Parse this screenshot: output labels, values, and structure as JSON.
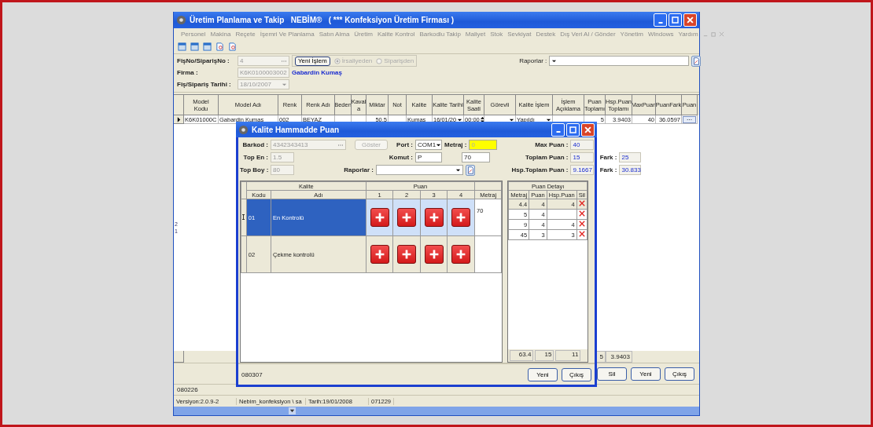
{
  "main_window": {
    "title": "Üretim Planlama ve Takip   NEBİM®   ( *** Konfeksiyon Üretim Firması )",
    "menu": [
      "Personel",
      "Makina",
      "Reçete",
      "İşemri Ve Planlama",
      "Satın Alma",
      "Üretim",
      "Kalite Kontrol",
      "Barkodlu Takip",
      "Maliyet",
      "Stok",
      "Sevkiyat",
      "Destek",
      "Dış Veri Al / Gönder",
      "Yönetim",
      "Windows",
      "Yardım"
    ],
    "form": {
      "fis_label": "FişNo/SiparişNo :",
      "fis_value": "4",
      "new_button": "Yeni İşlem",
      "sources": [
        {
          "label": "İrsaliyeden",
          "selected": true
        },
        {
          "label": "Siparişden",
          "selected": false
        }
      ],
      "reports_label": "Raporlar :",
      "firma_label": "Firma :",
      "firma_value": "K6K0100003002",
      "firma_name": "Gabardin Kumaş",
      "date_label": "Fiş/Sipariş Tarihi :",
      "date_value": "18/10/2007"
    },
    "side_marks": [
      "2",
      "1"
    ],
    "grid": {
      "columns": [
        "Model\nKodu",
        "Model Adı",
        "Renk",
        "Renk Adı",
        "Beden",
        "Kaval\na",
        "Miktar",
        "Not",
        "Kalite",
        "Kalite Tarihi",
        "Kalite\nSaati",
        "Görevli",
        "Kalite İşlem",
        "İşlem Açıklama",
        "Puan\nToplamı",
        "Hsp.Puan\nToplamı",
        "MaxPuan",
        "PuanFark",
        "Puan"
      ],
      "rows": [
        {
          "selected": true,
          "cells": [
            {
              "kind": "text",
              "text": "K6K01000C"
            },
            {
              "kind": "text",
              "text": "Gabardin Kumaş"
            },
            {
              "kind": "text",
              "text": "002"
            },
            {
              "kind": "text",
              "text": "BEYAZ"
            },
            {
              "kind": "empty"
            },
            {
              "kind": "empty"
            },
            {
              "kind": "num",
              "text": "50.5"
            },
            {
              "kind": "empty"
            },
            {
              "kind": "text",
              "text": "Kumaş"
            },
            {
              "kind": "combo",
              "text": "16/01/20"
            },
            {
              "kind": "spin",
              "text": "00:00"
            },
            {
              "kind": "combo",
              "text": ""
            },
            {
              "kind": "combo",
              "text": "Yapıldı"
            },
            {
              "kind": "empty"
            },
            {
              "kind": "num",
              "text": "5"
            },
            {
              "kind": "num",
              "text": "3.9403"
            },
            {
              "kind": "num",
              "text": "40"
            },
            {
              "kind": "num",
              "text": "36.0597"
            },
            {
              "kind": "ellipsis",
              "text": "···"
            }
          ]
        }
      ],
      "footer": [
        {
          "kind": "empty"
        },
        {
          "kind": "empty"
        },
        {
          "kind": "empty"
        },
        {
          "kind": "empty"
        },
        {
          "kind": "empty"
        },
        {
          "kind": "empty"
        },
        {
          "kind": "empty"
        },
        {
          "kind": "empty"
        },
        {
          "kind": "empty"
        },
        {
          "kind": "empty"
        },
        {
          "kind": "empty"
        },
        {
          "kind": "empty"
        },
        {
          "kind": "empty"
        },
        {
          "kind": "empty"
        },
        {
          "kind": "num",
          "text": "5"
        },
        {
          "kind": "num",
          "text": "3.9403"
        },
        {
          "kind": "empty"
        },
        {
          "kind": "empty"
        },
        {
          "kind": "empty"
        }
      ]
    },
    "buttons": [
      "Sil",
      "Yeni",
      "Çıkış"
    ],
    "status_line": "080226",
    "status_bar": [
      "Versiyon:2.0.9-2",
      "Nebim_konfeksiyon \\ sa",
      "Tarih:19/01/2008",
      "071229"
    ]
  },
  "dialog": {
    "title": "Kalite Hammadde Puan",
    "barkod_label": "Barkod :",
    "barkod_value": "4342343413",
    "show_button": "Göster",
    "top_en_label": "Top En :",
    "top_en_value": "1.5",
    "top_boy_label": "Top Boy :",
    "top_boy_value": "80",
    "port_label": "Port :",
    "port_value": "COM1",
    "metraj_label": "Metraj :",
    "metraj_value": "0",
    "komut_label": "Komut :",
    "komut_value": "P",
    "komut_extra": "70",
    "reports_label": "Raporlar :",
    "max_label": "Max Puan :",
    "max_value": "40",
    "total_label": "Toplam Puan :",
    "total_value": "15",
    "fark1_label": "Fark :",
    "fark1_value": "25",
    "hsp_label": "Hsp.Toplam Puan :",
    "hsp_value": "9.1667",
    "fark2_label": "Fark :",
    "fark2_value": "30.833",
    "grid": {
      "group_kalite": "Kalite",
      "group_puan": "Puan",
      "col_code": "Kodu",
      "col_name": "Adı",
      "puan_columns": [
        "1",
        "2",
        "3",
        "4"
      ],
      "col_metraj": "Metraj",
      "rows": [
        {
          "code": "01",
          "name": "En Kontrolü",
          "metraj": "70",
          "selected": true
        },
        {
          "code": "02",
          "name": "Çekme kontrolü",
          "selected": false
        }
      ]
    },
    "detail": {
      "title": "Puan Detayı",
      "columns": [
        "Metraj",
        "Puan",
        "Hsp.Puan",
        "Sil"
      ],
      "rows": [
        {
          "metraj": "4.4",
          "puan": "4",
          "hsp_puan": "4",
          "selected": true
        },
        {
          "metraj": "5",
          "puan": "4",
          "selected": false
        },
        {
          "metraj": "9",
          "puan": "4",
          "hsp_puan": "4",
          "selected": false
        },
        {
          "metraj": "45",
          "puan": "3",
          "hsp_puan": "3",
          "selected": false
        }
      ],
      "totals": [
        "63.4",
        "15",
        "11"
      ]
    },
    "footer_code": "080307",
    "buttons": [
      "Yeni",
      "Çıkış"
    ]
  }
}
